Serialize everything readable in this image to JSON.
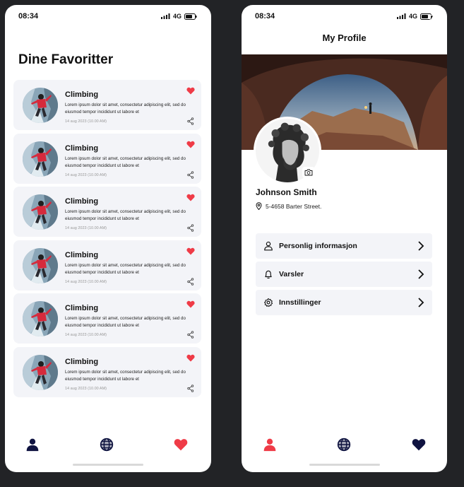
{
  "status_bar": {
    "time": "08:34",
    "network": "4G"
  },
  "favorites_screen": {
    "title": "Dine Favoritter",
    "items": [
      {
        "title": "Climbing",
        "description": "Lorem ipsum dolor sit amet, consectetur adipiscing elit, sed do eiusmod tempor incididunt ut labore et",
        "date": "14 aug 2023 (10.00 AM)"
      },
      {
        "title": "Climbing",
        "description": "Lorem ipsum dolor sit amet, consectetur adipiscing elit, sed do eiusmod tempor incididunt ut labore et",
        "date": "14 aug 2023 (10.00 AM)"
      },
      {
        "title": "Climbing",
        "description": "Lorem ipsum dolor sit amet, consectetur adipiscing elit, sed do eiusmod tempor incididunt ut labore et",
        "date": "14 aug 2023 (10.00 AM)"
      },
      {
        "title": "Climbing",
        "description": "Lorem ipsum dolor sit amet, consectetur adipiscing elit, sed do eiusmod tempor incididunt ut labore et",
        "date": "14 aug 2023 (10.00 AM)"
      },
      {
        "title": "Climbing",
        "description": "Lorem ipsum dolor sit amet, consectetur adipiscing elit, sed do eiusmod tempor incididunt ut labore et",
        "date": "14 aug 2023 (10.00 AM)"
      },
      {
        "title": "Climbing",
        "description": "Lorem ipsum dolor sit amet, consectetur adipiscing elit, sed do eiusmod tempor incididunt ut labore et",
        "date": "14 aug 2023 (10.00 AM)"
      }
    ]
  },
  "profile_screen": {
    "title": "My Profile",
    "name": "Johnson Smith",
    "address": "5-4658 Barter Street.",
    "menu": [
      {
        "label": "Personlig informasjon",
        "icon": "user-icon"
      },
      {
        "label": "Varsler",
        "icon": "bell-icon"
      },
      {
        "label": "Innstillinger",
        "icon": "gear-icon"
      }
    ]
  },
  "colors": {
    "accent_red": "#ef3b47",
    "navy": "#0f1340",
    "card_bg": "#f3f4f8",
    "background": "#222326"
  },
  "nav_icons": [
    "user-icon",
    "globe-icon",
    "heart-icon"
  ]
}
